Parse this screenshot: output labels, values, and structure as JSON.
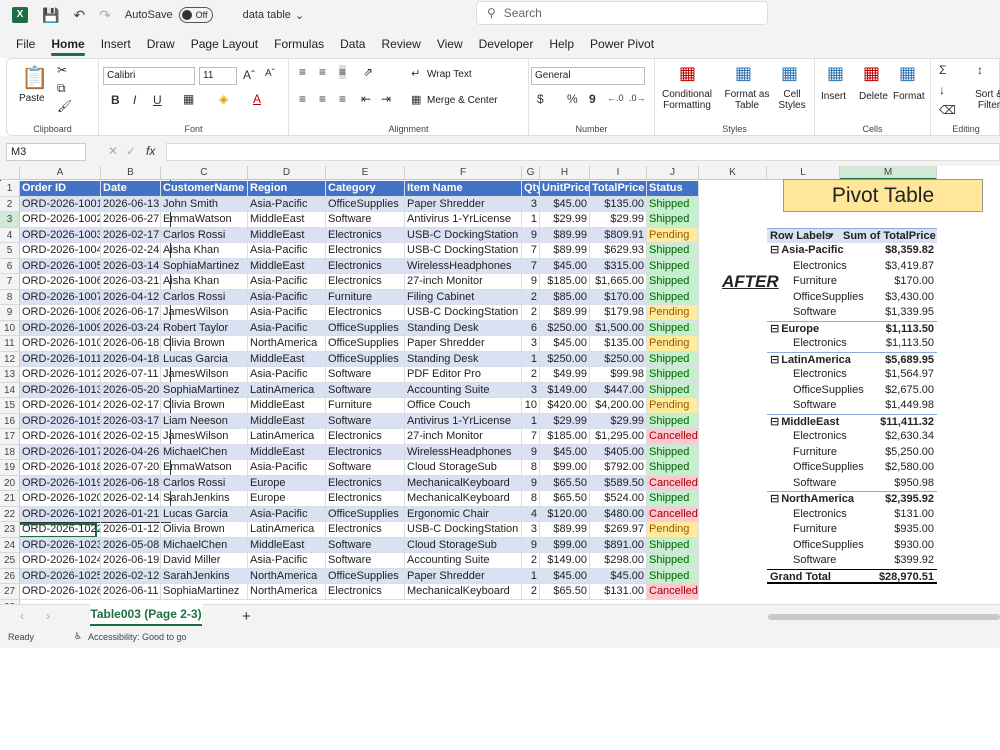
{
  "title": {
    "autosave_label": "AutoSave",
    "autosave_state": "Off",
    "file_name": "data table",
    "search_placeholder": "Search"
  },
  "tabs": [
    "File",
    "Home",
    "Insert",
    "Draw",
    "Page Layout",
    "Formulas",
    "Data",
    "Review",
    "View",
    "Developer",
    "Help",
    "Power Pivot"
  ],
  "ribbon": {
    "clipboard": {
      "label": "Clipboard",
      "paste": "Paste"
    },
    "font": {
      "label": "Font",
      "name": "Calibri",
      "size": "11",
      "bold": "B",
      "italic": "I",
      "underline": "U"
    },
    "alignment": {
      "label": "Alignment",
      "wrap": "Wrap Text",
      "merge": "Merge & Center"
    },
    "number": {
      "label": "Number",
      "format": "General",
      "currency": "$",
      "percent": "%",
      "comma": "9"
    },
    "styles": {
      "label": "Styles",
      "conditional": "Conditional Formatting",
      "format_table": "Format as Table",
      "cell_styles": "Cell Styles"
    },
    "cells": {
      "label": "Cells",
      "insert": "Insert",
      "delete": "Delete",
      "format": "Format"
    },
    "editing": {
      "label": "Editing",
      "sort": "Sort & Filter"
    }
  },
  "name_box": "M3",
  "columns": [
    "A",
    "B",
    "C",
    "D",
    "E",
    "F",
    "G",
    "H",
    "I",
    "J",
    "K",
    "L",
    "M"
  ],
  "table": {
    "headers": [
      "Order ID",
      "Date",
      "CustomerName",
      "Region",
      "Category",
      "Item Name",
      "Qty",
      "UnitPrice",
      "TotalPrice",
      "Status"
    ],
    "rows": [
      [
        "ORD-2026-1001",
        "2026-06-13",
        "John Smith",
        "Asia-Pacific",
        "OfficeSupplies",
        "Paper Shredder",
        "3",
        "$45.00",
        "$135.00",
        "Shipped"
      ],
      [
        "ORD-2026-1002",
        "2026-06-27",
        "EmmaWatson",
        "MiddleEast",
        "Software",
        "Antivirus 1-YrLicense",
        "1",
        "$29.99",
        "$29.99",
        "Shipped"
      ],
      [
        "ORD-2026-1003",
        "2026-02-17",
        "Carlos Rossi",
        "MiddleEast",
        "Electronics",
        "USB-C DockingStation",
        "9",
        "$89.99",
        "$809.91",
        "Pending"
      ],
      [
        "ORD-2026-1004",
        "2026-02-24",
        "Aisha Khan",
        "Asia-Pacific",
        "Electronics",
        "USB-C DockingStation",
        "7",
        "$89.99",
        "$629.93",
        "Shipped"
      ],
      [
        "ORD-2026-1005",
        "2026-03-14",
        "SophiaMartinez",
        "MiddleEast",
        "Electronics",
        "WirelessHeadphones",
        "7",
        "$45.00",
        "$315.00",
        "Shipped"
      ],
      [
        "ORD-2026-1006",
        "2026-03-21",
        "Aisha Khan",
        "Asia-Pacific",
        "Electronics",
        "27-inch Monitor",
        "9",
        "$185.00",
        "$1,665.00",
        "Shipped"
      ],
      [
        "ORD-2026-1007",
        "2026-04-12",
        "Carlos Rossi",
        "Asia-Pacific",
        "Furniture",
        "Filing Cabinet",
        "2",
        "$85.00",
        "$170.00",
        "Shipped"
      ],
      [
        "ORD-2026-1008",
        "2026-06-17",
        "JamesWilson",
        "Asia-Pacific",
        "Electronics",
        "USB-C DockingStation",
        "2",
        "$89.99",
        "$179.98",
        "Pending"
      ],
      [
        "ORD-2026-1009",
        "2026-03-24",
        "Robert Taylor",
        "Asia-Pacific",
        "OfficeSupplies",
        "Standing Desk",
        "6",
        "$250.00",
        "$1,500.00",
        "Shipped"
      ],
      [
        "ORD-2026-1010",
        "2026-06-18",
        "Olivia Brown",
        "NorthAmerica",
        "OfficeSupplies",
        "Paper Shredder",
        "3",
        "$45.00",
        "$135.00",
        "Pending"
      ],
      [
        "ORD-2026-1011",
        "2026-04-18",
        "Lucas Garcia",
        "MiddleEast",
        "OfficeSupplies",
        "Standing Desk",
        "1",
        "$250.00",
        "$250.00",
        "Shipped"
      ],
      [
        "ORD-2026-1012",
        "2026-07-11",
        "JamesWilson",
        "Asia-Pacific",
        "Software",
        "PDF Editor Pro",
        "2",
        "$49.99",
        "$99.98",
        "Shipped"
      ],
      [
        "ORD-2026-1013",
        "2026-05-20",
        "SophiaMartinez",
        "LatinAmerica",
        "Software",
        "Accounting Suite",
        "3",
        "$149.00",
        "$447.00",
        "Shipped"
      ],
      [
        "ORD-2026-1014",
        "2026-02-17",
        "Olivia Brown",
        "MiddleEast",
        "Furniture",
        "Office Couch",
        "10",
        "$420.00",
        "$4,200.00",
        "Pending"
      ],
      [
        "ORD-2026-1015",
        "2026-03-17",
        "Liam Neeson",
        "MiddleEast",
        "Software",
        "Antivirus 1-YrLicense",
        "1",
        "$29.99",
        "$29.99",
        "Shipped"
      ],
      [
        "ORD-2026-1016",
        "2026-02-15",
        "JamesWilson",
        "LatinAmerica",
        "Electronics",
        "27-inch Monitor",
        "7",
        "$185.00",
        "$1,295.00",
        "Cancelled"
      ],
      [
        "ORD-2026-1017",
        "2026-04-26",
        "MichaelChen",
        "MiddleEast",
        "Electronics",
        "WirelessHeadphones",
        "9",
        "$45.00",
        "$405.00",
        "Shipped"
      ],
      [
        "ORD-2026-1018",
        "2026-07-20",
        "EmmaWatson",
        "Asia-Pacific",
        "Software",
        "Cloud StorageSub",
        "8",
        "$99.00",
        "$792.00",
        "Shipped"
      ],
      [
        "ORD-2026-1019",
        "2026-06-18",
        "Carlos Rossi",
        "Europe",
        "Electronics",
        "MechanicalKeyboard",
        "9",
        "$65.50",
        "$589.50",
        "Cancelled"
      ],
      [
        "ORD-2026-1020",
        "2026-02-14",
        "SarahJenkins",
        "Europe",
        "Electronics",
        "MechanicalKeyboard",
        "8",
        "$65.50",
        "$524.00",
        "Shipped"
      ],
      [
        "ORD-2026-1021",
        "2026-01-21",
        "Lucas Garcia",
        "Asia-Pacific",
        "OfficeSupplies",
        "Ergonomic Chair",
        "4",
        "$120.00",
        "$480.00",
        "Cancelled"
      ],
      [
        "ORD-2026-1022",
        "2026-01-12",
        "Olivia Brown",
        "LatinAmerica",
        "Electronics",
        "USB-C DockingStation",
        "3",
        "$89.99",
        "$269.97",
        "Pending"
      ],
      [
        "ORD-2026-1023",
        "2026-05-08",
        "MichaelChen",
        "MiddleEast",
        "Software",
        "Cloud StorageSub",
        "9",
        "$99.00",
        "$891.00",
        "Shipped"
      ],
      [
        "ORD-2026-1024",
        "2026-06-19",
        "David Miller",
        "Asia-Pacific",
        "Software",
        "Accounting Suite",
        "2",
        "$149.00",
        "$298.00",
        "Shipped"
      ],
      [
        "ORD-2026-1025",
        "2026-02-12",
        "SarahJenkins",
        "NorthAmerica",
        "OfficeSupplies",
        "Paper Shredder",
        "1",
        "$45.00",
        "$45.00",
        "Shipped"
      ],
      [
        "ORD-2026-1026",
        "2026-06-11",
        "SophiaMartinez",
        "NorthAmerica",
        "Electronics",
        "MechanicalKeyboard",
        "2",
        "$65.50",
        "$131.00",
        "Cancelled"
      ]
    ]
  },
  "pivot": {
    "title": "Pivot Table",
    "annotation": "AFTER",
    "header_labels": "Row Labels",
    "header_values": "Sum of TotalPrice",
    "rows": [
      {
        "label": "Asia-Pacific",
        "value": "$8,359.82",
        "level": 0
      },
      {
        "label": "Electronics",
        "value": "$3,419.87",
        "level": 1
      },
      {
        "label": "Furniture",
        "value": "$170.00",
        "level": 1
      },
      {
        "label": "OfficeSupplies",
        "value": "$3,430.00",
        "level": 1
      },
      {
        "label": "Software",
        "value": "$1,339.95",
        "level": 1
      },
      {
        "label": "Europe",
        "value": "$1,113.50",
        "level": 0
      },
      {
        "label": "Electronics",
        "value": "$1,113.50",
        "level": 1
      },
      {
        "label": "LatinAmerica",
        "value": "$5,689.95",
        "level": 0
      },
      {
        "label": "Electronics",
        "value": "$1,564.97",
        "level": 1
      },
      {
        "label": "OfficeSupplies",
        "value": "$2,675.00",
        "level": 1
      },
      {
        "label": "Software",
        "value": "$1,449.98",
        "level": 1
      },
      {
        "label": "MiddleEast",
        "value": "$11,411.32",
        "level": 0
      },
      {
        "label": "Electronics",
        "value": "$2,630.34",
        "level": 1
      },
      {
        "label": "Furniture",
        "value": "$5,250.00",
        "level": 1
      },
      {
        "label": "OfficeSupplies",
        "value": "$2,580.00",
        "level": 1
      },
      {
        "label": "Software",
        "value": "$950.98",
        "level": 1
      },
      {
        "label": "NorthAmerica",
        "value": "$2,395.92",
        "level": 0
      },
      {
        "label": "Electronics",
        "value": "$131.00",
        "level": 1
      },
      {
        "label": "Furniture",
        "value": "$935.00",
        "level": 1
      },
      {
        "label": "OfficeSupplies",
        "value": "$930.00",
        "level": 1
      },
      {
        "label": "Software",
        "value": "$399.92",
        "level": 1
      }
    ],
    "grand_total_label": "Grand Total",
    "grand_total_value": "$28,970.51"
  },
  "sheet_tab": "Table003 (Page 2-3)",
  "status": {
    "ready": "Ready",
    "accessibility": "Accessibility: Good to go"
  },
  "colors": {
    "header": "#4472c4",
    "band": "#d9e1f2",
    "shipped": "#c6efce",
    "pending": "#ffeb9c",
    "cancelled": "#ffc7ce",
    "pivot_title": "#ffe699",
    "accent": "#1d6f42"
  }
}
